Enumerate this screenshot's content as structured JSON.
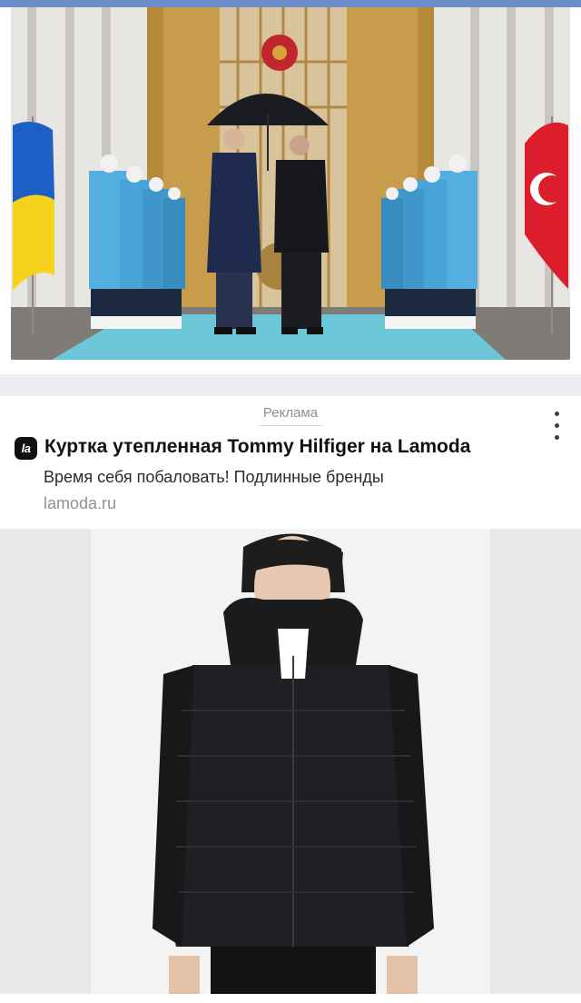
{
  "post": {
    "photo_alt": ""
  },
  "ad": {
    "label": "Реклама",
    "brand_logo_text": "la",
    "title": "Куртка утепленная Tommy Hilfiger на Lamoda",
    "description": "Время себя побаловать! Подлинные бренды",
    "domain": "lamoda.ru"
  },
  "icons": {
    "more": "more-vertical-icon",
    "brand": "lamoda-logo-icon"
  },
  "colors": {
    "top_strip": "#6b8cc7",
    "separator": "#ebedf0",
    "ad_label": "#8a8f96",
    "domain": "#8d9299"
  }
}
